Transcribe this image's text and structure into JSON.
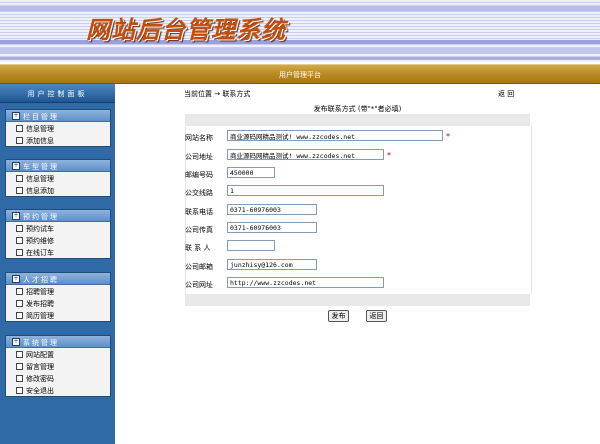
{
  "header": {
    "logo_text": "网站后台管理系统"
  },
  "topbar": {
    "title": "用户管理平台"
  },
  "sidebar": {
    "title": "用户控制面板",
    "menus": [
      {
        "title": "栏目管理",
        "items": [
          "信息管理",
          "添加信息"
        ]
      },
      {
        "title": "车型管理",
        "items": [
          "信息管理",
          "信息添加"
        ]
      },
      {
        "title": "预约管理",
        "items": [
          "预约试车",
          "预约维修",
          "在线订车"
        ]
      },
      {
        "title": "人才招聘",
        "items": [
          "招聘管理",
          "发布招聘",
          "简历管理"
        ]
      },
      {
        "title": "系统管理",
        "items": [
          "网站配置",
          "留言管理",
          "修改密码",
          "安全退出"
        ]
      }
    ]
  },
  "main": {
    "breadcrumb": "当前位置 → 联系方式",
    "back_label": "返 回",
    "form_title": "发布联系方式 (带\"*\"者必填)",
    "fields": [
      {
        "label": "网站名称",
        "value": "商业源码网精品测试! www.zzcodes.net",
        "required": true
      },
      {
        "label": "公司地址",
        "value": "商业源码网精品测试! www.zzcodes.net",
        "required": true
      },
      {
        "label": "邮编号码",
        "value": "450000"
      },
      {
        "label": "公交线路",
        "value": "1"
      },
      {
        "label": "联系电话",
        "value": "0371-60976003"
      },
      {
        "label": "公司传真",
        "value": "0371-60976003"
      },
      {
        "label": "联 系 人",
        "value": ""
      },
      {
        "label": "公司邮箱",
        "value": "junzhisy@126.com"
      },
      {
        "label": "公司网址",
        "value": "http://www.zzcodes.net"
      }
    ],
    "buttons": {
      "submit": "发布",
      "back": "返回"
    }
  }
}
